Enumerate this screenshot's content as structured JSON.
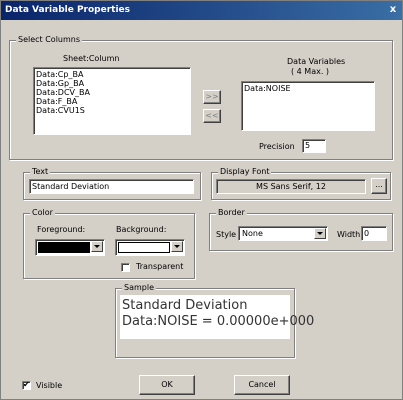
{
  "window": {
    "title": "Data Variable Properties",
    "close_glyph": "x"
  },
  "select_columns": {
    "group_label": "Select Columns",
    "sheet_column_header": "Sheet:Column",
    "sheet_items": [
      "Data:Cp_BA",
      "Data:Gp_BA",
      "Data:DCV_BA",
      "Data:F_BA",
      "Data:CVU1S"
    ],
    "data_variables_header_1": "Data Variables",
    "data_variables_header_2": "( 4 Max. )",
    "data_variable_items": [
      "Data:NOISE"
    ],
    "add_label": ">>",
    "remove_label": "<<",
    "precision_label": "Precision",
    "precision_value": "5"
  },
  "text_group": {
    "group_label": "Text",
    "value": "Standard Deviation"
  },
  "display_font": {
    "group_label": "Display Font",
    "value": "MS Sans Serif, 12",
    "browse_label": "..."
  },
  "color": {
    "group_label": "Color",
    "foreground_label": "Foreground:",
    "background_label": "Background:",
    "foreground_color": "#000000",
    "background_color": "#ffffff",
    "transparent_label": "Transparent",
    "transparent_checked": false
  },
  "border": {
    "group_label": "Border",
    "style_label": "Style",
    "style_value": "None",
    "width_label": "Width",
    "width_value": "0"
  },
  "sample": {
    "group_label": "Sample",
    "line1": "Standard Deviation",
    "line2": "Data:NOISE = 0.00000e+000"
  },
  "footer": {
    "visible_label": "Visible",
    "visible_checked": true,
    "ok_label": "OK",
    "cancel_label": "Cancel"
  }
}
